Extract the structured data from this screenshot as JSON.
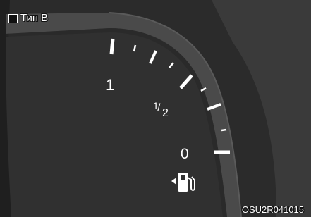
{
  "type_label": "Тип B",
  "gauge": {
    "full_label": "1",
    "half_numerator": "1",
    "half_slash": "/",
    "half_denominator": "2",
    "empty_label": "0"
  },
  "icons": {
    "fuel": "fuel-pump-icon",
    "filler_side": "arrow-left-icon"
  },
  "reference_code": "OSU2R041015",
  "colors": {
    "background": "#2d2d2d",
    "dial_band": "#474747",
    "marks": "#ffffff"
  }
}
